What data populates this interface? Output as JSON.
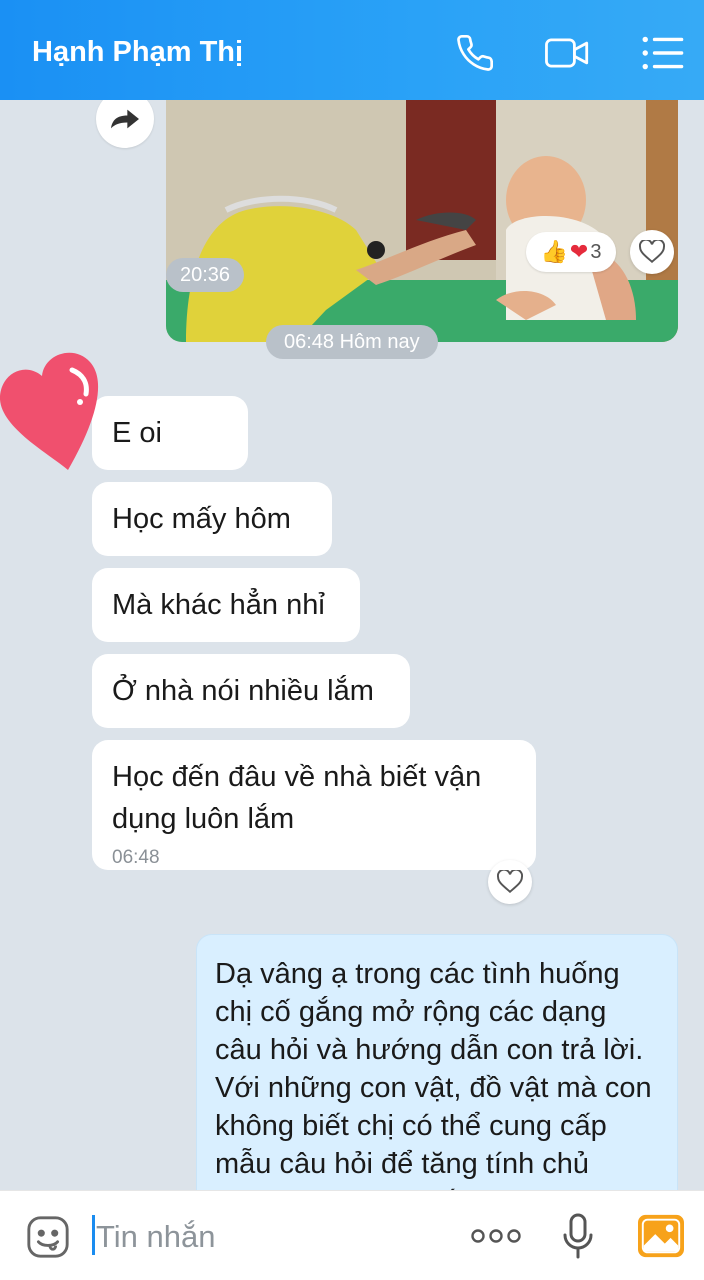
{
  "header": {
    "title": "Hạnh Phạm Thị",
    "icons": [
      "phone-icon",
      "video-call-icon",
      "menu-list-icon"
    ],
    "bg_color": "#1a90f4"
  },
  "video_message": {
    "time": "20:36",
    "reaction_count": "3",
    "reactions": [
      "thumbs-up",
      "heart"
    ]
  },
  "date_divider": "06:48 Hôm nay",
  "incoming_messages": [
    {
      "text": "E oi"
    },
    {
      "text": "Học mấy hôm"
    },
    {
      "text": "Mà khác hẳn nhỉ"
    },
    {
      "text": "Ở nhà nói nhiều lắm"
    },
    {
      "text": "Học đến đâu về nhà biết vận dụng luôn lắm",
      "time": "06:48"
    }
  ],
  "outgoing_message": {
    "text": "Dạ vâng ạ trong các tình huống chị cố gắng mở rộng các dạng câu hỏi và hướng dẫn con trả lời. Với những con vật, đồ vật mà con không biết chị có thể cung cấp mẫu câu hỏi để tăng tính chủ động trong giao tiếp"
  },
  "input": {
    "placeholder": "Tin nhắn",
    "icons": [
      "sticker-icon",
      "more-icon",
      "microphone-icon",
      "image-icon"
    ]
  },
  "colors": {
    "accent": "#1a90f4",
    "chat_bg": "#dce3ea",
    "outgoing_bubble": "#d9efff",
    "heart": "#f0506e"
  }
}
